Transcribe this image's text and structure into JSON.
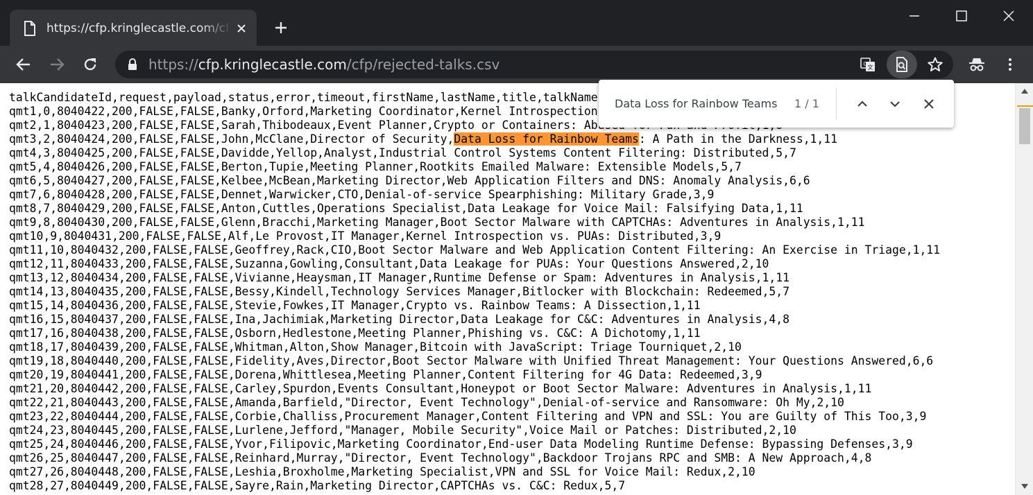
{
  "tab": {
    "title": "https://cfp.kringlecastle.com/cfp/rejected-talks.csv"
  },
  "address_bar": {
    "scheme": "https://",
    "host": "cfp.kringlecastle.com",
    "path": "/cfp/rejected-talks.csv"
  },
  "find_bar": {
    "query": "Data Loss for Rainbow Teams",
    "count": "1 / 1"
  },
  "csv": {
    "line_before": "talkCandidateId,request,payload,status,error,timeout,firstName,lastName,title,talkName,abstract,...\nqmt1,0,8040422,200,FALSE,FALSE,Banky,Orford,Marketing Coordinator,Kernel Introspection Software Design,4,11\nqmt2,1,8040423,200,FALSE,FALSE,Sarah,Thibodeaux,Event Planner,Crypto or Containers: Abused for Fun and Profit,1,8\nqmt3,2,8040424,200,FALSE,FALSE,John,McClane,Director of Security,",
    "highlight": "Data Loss for Rainbow Teams",
    "line_after": ": A Path in the Darkness,1,11\nqmt4,3,8040425,200,FALSE,FALSE,Davidde,Yellop,Analyst,Industrial Control Systems Content Filtering: Distributed,5,7\nqmt5,4,8040426,200,FALSE,FALSE,Berton,Tupie,Meeting Planner,Rootkits Emailed Malware: Extensible Models,5,7\nqmt6,5,8040427,200,FALSE,FALSE,Kelbee,McBean,Marketing Director,Web Application Filters and DNS: Anomaly Analysis,6,6\nqmt7,6,8040428,200,FALSE,FALSE,Dennet,Warwicker,CTO,Denial-of-service Spearphishing: Military Grade,3,9\nqmt8,7,8040429,200,FALSE,FALSE,Anton,Cuttles,Operations Specialist,Data Leakage for Voice Mail: Falsifying Data,1,11\nqmt9,8,8040430,200,FALSE,FALSE,Glenn,Bracchi,Marketing Manager,Boot Sector Malware with CAPTCHAs: Adventures in Analysis,1,11\nqmt10,9,8040431,200,FALSE,FALSE,Alf,Le Provost,IT Manager,Kernel Introspection vs. PUAs: Distributed,3,9\nqmt11,10,8040432,200,FALSE,FALSE,Geoffrey,Rack,CIO,Boot Sector Malware and Web Application Content Filtering: An Exercise in Triage,1,11\nqmt12,11,8040433,200,FALSE,FALSE,Suzanna,Gowling,Consultant,Data Leakage for PUAs: Your Questions Answered,2,10\nqmt13,12,8040434,200,FALSE,FALSE,Vivianne,Heaysman,IT Manager,Runtime Defense or Spam: Adventures in Analysis,1,11\nqmt14,13,8040435,200,FALSE,FALSE,Bessy,Kindell,Technology Services Manager,Bitlocker with Blockchain: Redeemed,5,7\nqmt15,14,8040436,200,FALSE,FALSE,Stevie,Fowkes,IT Manager,Crypto vs. Rainbow Teams: A Dissection,1,11\nqmt16,15,8040437,200,FALSE,FALSE,Ina,Jachimiak,Marketing Director,Data Leakage for C&C: Adventures in Analysis,4,8\nqmt17,16,8040438,200,FALSE,FALSE,Osborn,Hedlestone,Meeting Planner,Phishing vs. C&C: A Dichotomy,1,11\nqmt18,17,8040439,200,FALSE,FALSE,Whitman,Alton,Show Manager,Bitcoin with JavaScript: Triage Tourniquet,2,10\nqmt19,18,8040440,200,FALSE,FALSE,Fidelity,Aves,Director,Boot Sector Malware with Unified Threat Management: Your Questions Answered,6,6\nqmt20,19,8040441,200,FALSE,FALSE,Dorena,Whittlesea,Meeting Planner,Content Filtering for 4G Data: Redeemed,3,9\nqmt21,20,8040442,200,FALSE,FALSE,Carley,Spurdon,Events Consultant,Honeypot or Boot Sector Malware: Adventures in Analysis,1,11\nqmt22,21,8040443,200,FALSE,FALSE,Amanda,Barfield,\"Director, Event Technology\",Denial-of-service and Ransomware: Oh My,2,10\nqmt23,22,8040444,200,FALSE,FALSE,Corbie,Challiss,Procurement Manager,Content Filtering and VPN and SSL: You are Guilty of This Too,3,9\nqmt24,23,8040445,200,FALSE,FALSE,Lurlene,Jefford,\"Manager, Mobile Security\",Voice Mail or Patches: Distributed,2,10\nqmt25,24,8040446,200,FALSE,FALSE,Yvor,Filipovic,Marketing Coordinator,End-user Data Modeling Runtime Defense: Bypassing Defenses,3,9\nqmt26,25,8040447,200,FALSE,FALSE,Reinhard,Murray,\"Director, Event Technology\",Backdoor Trojans RPC and SMB: A New Approach,4,8\nqmt27,26,8040448,200,FALSE,FALSE,Leshia,Broxholme,Marketing Specialist,VPN and SSL for Voice Mail: Redux,2,10\nqmt28,27,8040449,200,FALSE,FALSE,Sayre,Rain,Marketing Director,CAPTCHAs vs. C&C: Redux,5,7"
  },
  "icons": {
    "tab": "file-icon",
    "tab_close": "close-icon",
    "new_tab": "plus-icon",
    "back": "arrow-left-icon",
    "forward": "arrow-right-icon",
    "reload": "reload-icon",
    "lock": "lock-icon",
    "translate": "translate-icon",
    "find": "find-in-page-icon",
    "bookmark": "star-icon",
    "incognito": "incognito-icon",
    "menu": "kebab-menu-icon"
  },
  "colors": {
    "frame": "#202124",
    "toolbar": "#35363a",
    "highlight": "#ff9632"
  }
}
